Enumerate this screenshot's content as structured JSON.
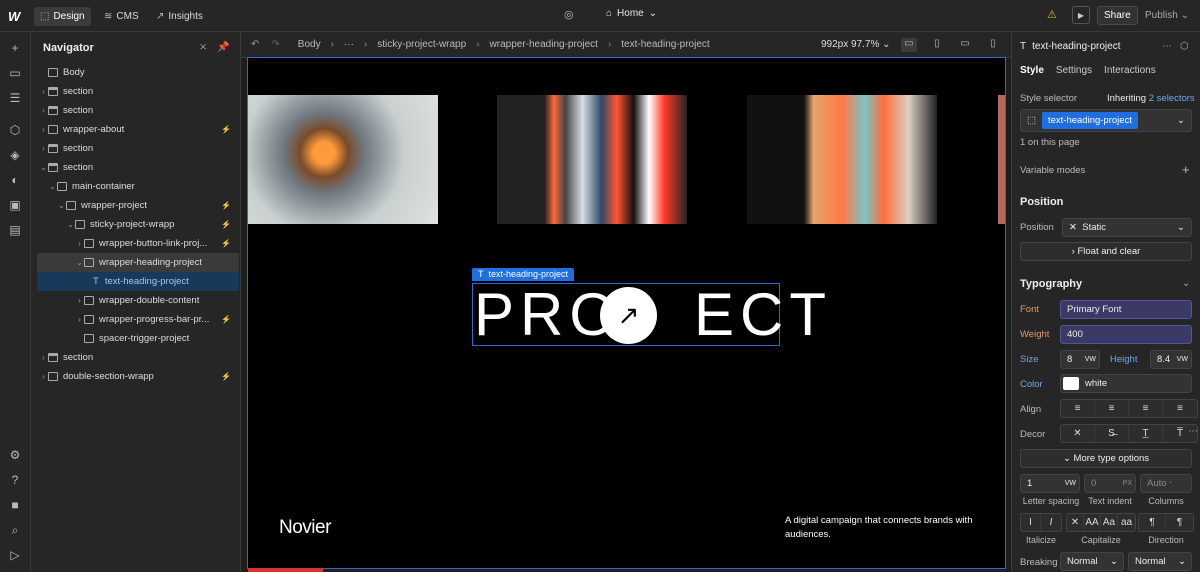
{
  "topbar": {
    "logo": "W",
    "tabs": [
      {
        "label": "Design",
        "icon": "cursor-icon"
      },
      {
        "label": "CMS",
        "icon": "database-icon"
      },
      {
        "label": "Insights",
        "icon": "chart-icon"
      }
    ],
    "page": "Home",
    "share": "Share",
    "publish": "Publish"
  },
  "navigator": {
    "title": "Navigator",
    "items": [
      {
        "label": "Body"
      },
      {
        "label": "section"
      },
      {
        "label": "section"
      },
      {
        "label": "wrapper-about"
      },
      {
        "label": "section"
      },
      {
        "label": "section"
      },
      {
        "label": "main-container"
      },
      {
        "label": "wrapper-project"
      },
      {
        "label": "sticky-project-wrapp"
      },
      {
        "label": "wrapper-button-link-proj..."
      },
      {
        "label": "wrapper-heading-project"
      },
      {
        "label": "text-heading-project"
      },
      {
        "label": "wrapper-double-content"
      },
      {
        "label": "wrapper-progress-bar-pr..."
      },
      {
        "label": "spacer-trigger-project"
      },
      {
        "label": "section"
      },
      {
        "label": "double-section-wrapp"
      }
    ]
  },
  "breadcrumb": {
    "items": [
      "Body",
      "···",
      "sticky-project-wrapp",
      "wrapper-heading-project",
      "text-heading-project"
    ],
    "viewport": "992px 97.7%"
  },
  "canvas": {
    "selection_label": "text-heading-project",
    "heading_left": "PRO",
    "heading_right": "ECT",
    "arrow": "↗",
    "brand": "Novier",
    "description": "A digital campaign that connects brands with audiences."
  },
  "style_panel": {
    "element": "text-heading-project",
    "tabs": [
      "Style",
      "Settings",
      "Interactions"
    ],
    "selector_label": "Style selector",
    "inheriting_prefix": "Inheriting",
    "inheriting_count": "2 selectors",
    "selector_chip": "text-heading-project",
    "on_page": "1 on this page",
    "variable_modes": "Variable modes",
    "position_title": "Position",
    "position_label": "Position",
    "position_value": "Static",
    "float_clear": "Float and clear",
    "typography_title": "Typography",
    "font_label": "Font",
    "font_value": "Primary Font",
    "weight_label": "Weight",
    "weight_value": "400",
    "size_label": "Size",
    "size_value": "8",
    "size_unit": "VW",
    "height_label": "Height",
    "height_value": "8.4",
    "height_unit": "VW",
    "color_label": "Color",
    "color_value": "white",
    "align_label": "Align",
    "decor_label": "Decor",
    "more_type": "More type options",
    "letter_spacing_value": "1",
    "letter_spacing_unit": "VW",
    "text_indent_value": "0",
    "text_indent_unit": "PX",
    "columns_value": "Auto",
    "letter_spacing_label": "Letter spacing",
    "text_indent_label": "Text indent",
    "columns_label": "Columns",
    "italicize_label": "Italicize",
    "capitalize_label": "Capitalize",
    "direction_label": "Direction",
    "breaking_label": "Breaking",
    "breaking_value1": "Normal",
    "breaking_value2": "Normal"
  },
  "colors": {
    "accent": "#1f6fe0",
    "canvas": "#000000",
    "panel": "#262626"
  }
}
